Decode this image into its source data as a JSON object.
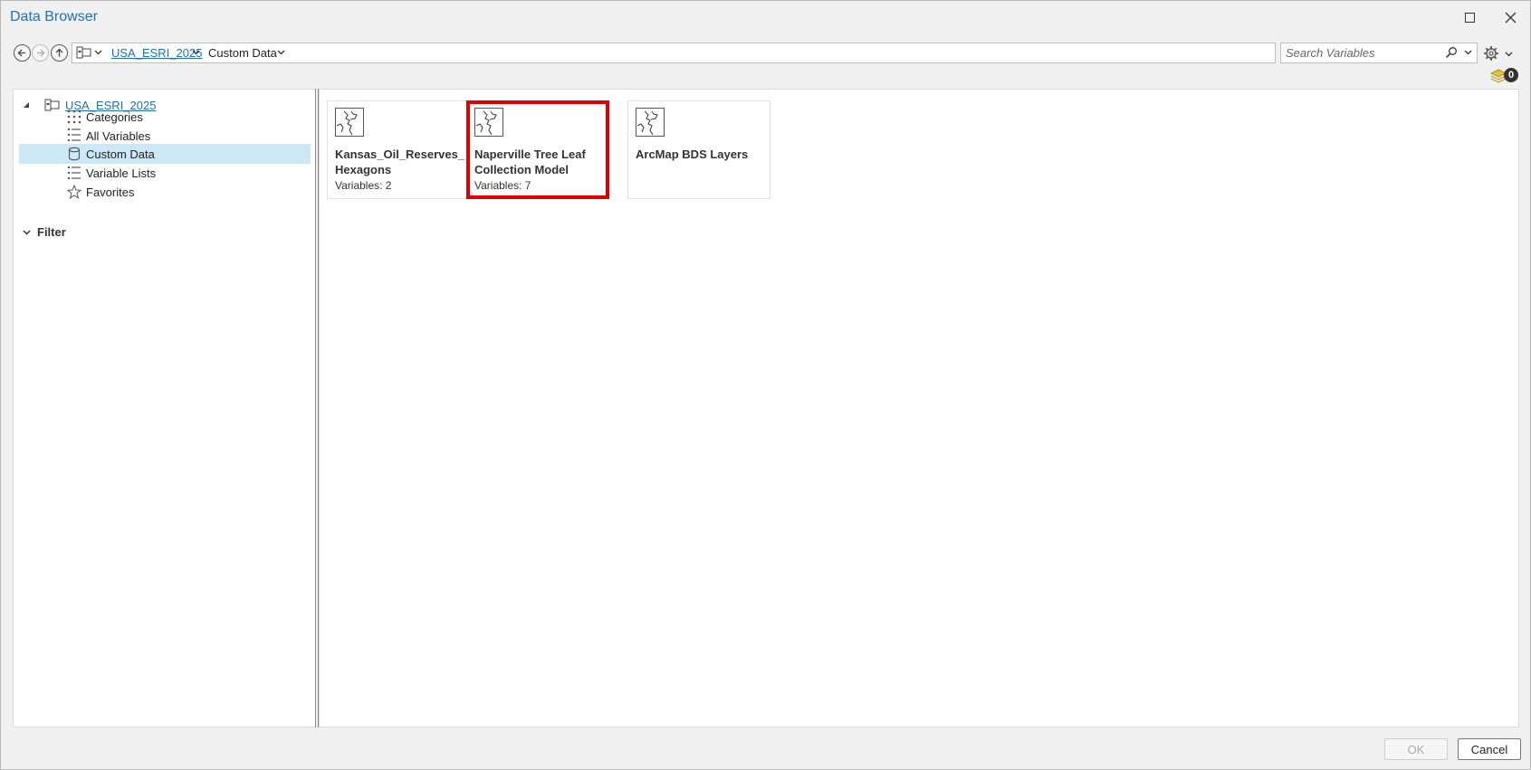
{
  "window": {
    "title": "Data Browser"
  },
  "toolbar": {
    "breadcrumb": [
      {
        "label": "USA_ESRI_2025",
        "link": true
      },
      {
        "label": "Custom Data",
        "link": false
      }
    ],
    "search": {
      "placeholder": "Search Variables",
      "value": ""
    },
    "layers_count": "0"
  },
  "tree": {
    "root": "USA_ESRI_2025",
    "items": [
      {
        "label": "Categories",
        "icon": "grid-dots-icon"
      },
      {
        "label": "All Variables",
        "icon": "list-icon"
      },
      {
        "label": "Custom Data",
        "icon": "database-icon",
        "selected": true
      },
      {
        "label": "Variable Lists",
        "icon": "list-icon"
      },
      {
        "label": "Favorites",
        "icon": "star-icon"
      }
    ],
    "filter_label": "Filter"
  },
  "cards": [
    {
      "title": "Kansas_Oil_Reserves_Hexagons",
      "subtitle": "Variables: 2",
      "icon": "map-outline-icon"
    },
    {
      "title": "Naperville Tree Leaf Collection Model",
      "subtitle": "Variables: 7",
      "icon": "map-outline-icon",
      "highlighted": true
    },
    {
      "title": "ArcMap BDS Layers",
      "subtitle": "",
      "icon": "map-outline-icon"
    }
  ],
  "footer": {
    "ok_label": "OK",
    "cancel_label": "Cancel"
  },
  "colors": {
    "accent": "#1f6fb5",
    "selection": "#cce8f7",
    "highlight_border": "#e00000"
  }
}
